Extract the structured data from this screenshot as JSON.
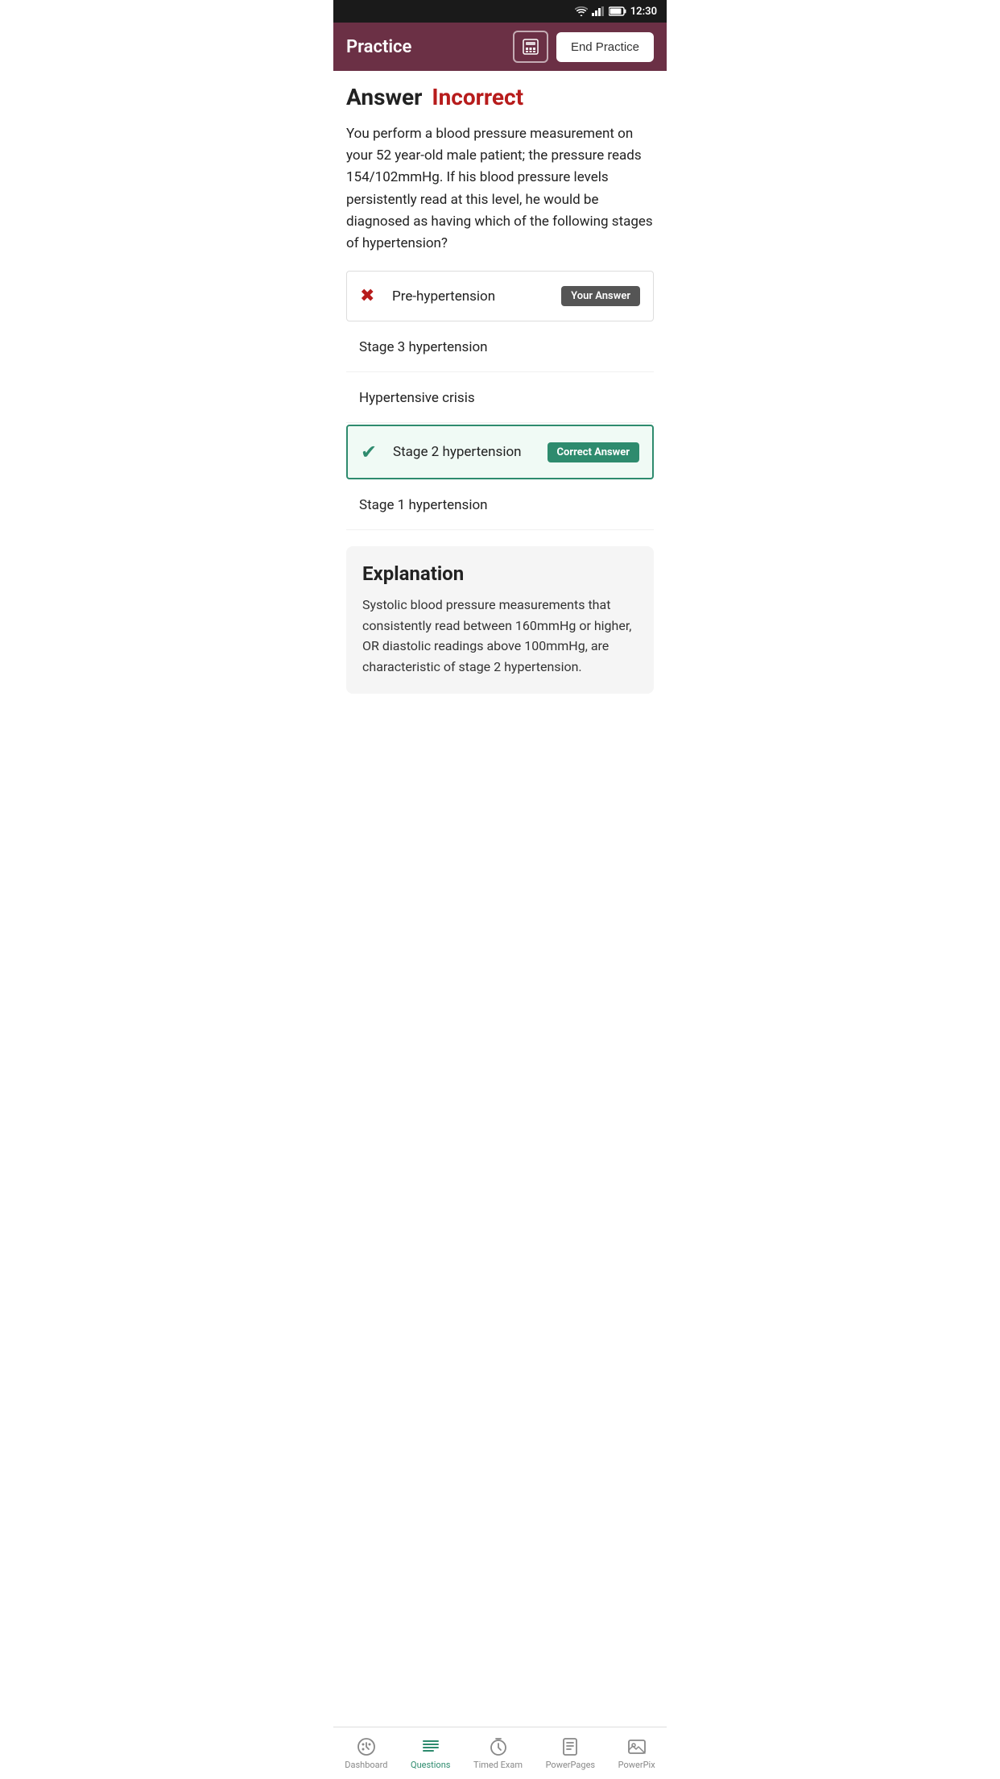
{
  "statusBar": {
    "time": "12:30",
    "wifiIcon": "wifi",
    "signalIcon": "signal",
    "batteryIcon": "battery"
  },
  "header": {
    "title": "Practice",
    "calcButtonLabel": "⊞",
    "endPracticeLabel": "End Practice"
  },
  "answerSection": {
    "answerLabel": "Answer",
    "resultLabel": "Incorrect",
    "questionText": "You perform a blood pressure measurement on your 52 year-old male patient; the pressure reads 154/102mmHg. If his blood pressure levels persistently read at this level, he would be diagnosed as having which of the following stages of hypertension?"
  },
  "options": [
    {
      "id": "opt1",
      "text": "Pre-hypertension",
      "type": "incorrect",
      "badge": "Your Answer"
    },
    {
      "id": "opt2",
      "text": "Stage 3 hypertension",
      "type": "plain",
      "badge": null
    },
    {
      "id": "opt3",
      "text": "Hypertensive crisis",
      "type": "plain",
      "badge": null
    },
    {
      "id": "opt4",
      "text": "Stage 2 hypertension",
      "type": "correct",
      "badge": "Correct Answer"
    },
    {
      "id": "opt5",
      "text": "Stage 1 hypertension",
      "type": "plain",
      "badge": null
    }
  ],
  "explanation": {
    "title": "Explanation",
    "text": "Systolic blood pressure measurements that consistently read between 160mmHg or higher, OR diastolic readings above 100mmHg, are characteristic of stage 2 hypertension."
  },
  "bottomNav": {
    "items": [
      {
        "id": "dashboard",
        "label": "Dashboard",
        "active": false
      },
      {
        "id": "questions",
        "label": "Questions",
        "active": true
      },
      {
        "id": "timedExam",
        "label": "Timed Exam",
        "active": false
      },
      {
        "id": "powerPages",
        "label": "PowerPages",
        "active": false
      },
      {
        "id": "powerPix",
        "label": "PowerPix",
        "active": false
      }
    ]
  }
}
